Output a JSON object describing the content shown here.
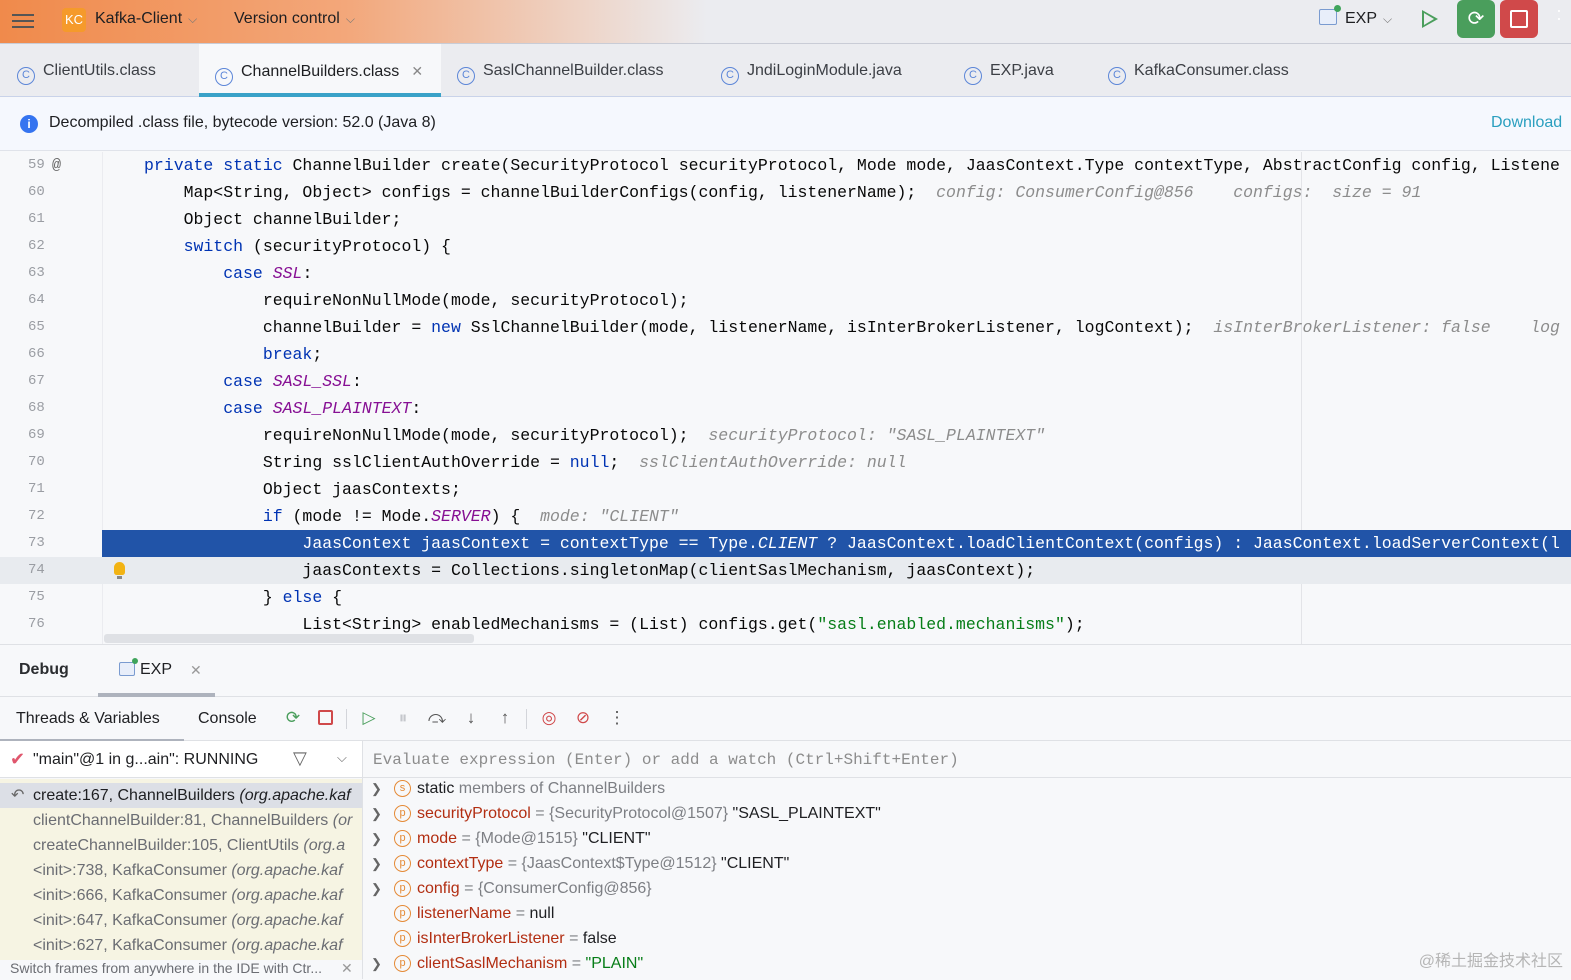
{
  "topbar": {
    "project_badge": "KC",
    "project": "Kafka-Client",
    "vcs": "Version control",
    "run_config": "EXP"
  },
  "tabs": [
    {
      "label": "ClientUtils.class",
      "active": false
    },
    {
      "label": "ChannelBuilders.class",
      "active": true
    },
    {
      "label": "SaslChannelBuilder.class",
      "active": false
    },
    {
      "label": "JndiLoginModule.java",
      "active": false
    },
    {
      "label": "EXP.java",
      "active": false
    },
    {
      "label": "KafkaConsumer.class",
      "active": false
    }
  ],
  "banner": {
    "text": "Decompiled .class file, bytecode version: 52.0 (Java 8)",
    "action": "Download"
  },
  "code": [
    {
      "n": "59",
      "t": [
        [
          "k",
          "private static "
        ],
        [
          "p",
          "ChannelBuilder create(SecurityProtocol securityProtocol, Mode mode, JaasContext.Type contextType, AbstractConfig config, Listene"
        ]
      ]
    },
    {
      "n": "60",
      "t": [
        [
          "p",
          "    Map<String, Object> configs = channelBuilderConfigs(config, listenerName);  "
        ],
        [
          "h",
          "config: ConsumerConfig@856    configs:  size = 91"
        ]
      ]
    },
    {
      "n": "61",
      "t": [
        [
          "p",
          "    Object channelBuilder;"
        ]
      ]
    },
    {
      "n": "62",
      "t": [
        [
          "k",
          "    switch "
        ],
        [
          "p",
          "(securityProtocol) {"
        ]
      ]
    },
    {
      "n": "63",
      "t": [
        [
          "k",
          "        case "
        ],
        [
          "e",
          "SSL"
        ],
        [
          "p",
          ":"
        ]
      ]
    },
    {
      "n": "64",
      "t": [
        [
          "p",
          "            requireNonNullMode(mode, securityProtocol);"
        ]
      ]
    },
    {
      "n": "65",
      "t": [
        [
          "p",
          "            channelBuilder = "
        ],
        [
          "k",
          "new "
        ],
        [
          "p",
          "SslChannelBuilder(mode, listenerName, isInterBrokerListener, logContext);  "
        ],
        [
          "h",
          "isInterBrokerListener: false    log"
        ]
      ]
    },
    {
      "n": "66",
      "t": [
        [
          "k",
          "            break"
        ],
        [
          "p",
          ";"
        ]
      ]
    },
    {
      "n": "67",
      "t": [
        [
          "k",
          "        case "
        ],
        [
          "e",
          "SASL_SSL"
        ],
        [
          "p",
          ":"
        ]
      ]
    },
    {
      "n": "68",
      "t": [
        [
          "k",
          "        case "
        ],
        [
          "e",
          "SASL_PLAINTEXT"
        ],
        [
          "p",
          ":"
        ]
      ]
    },
    {
      "n": "69",
      "t": [
        [
          "p",
          "            requireNonNullMode(mode, securityProtocol);  "
        ],
        [
          "h",
          "securityProtocol: \"SASL_PLAINTEXT\""
        ]
      ]
    },
    {
      "n": "70",
      "t": [
        [
          "p",
          "            String sslClientAuthOverride = "
        ],
        [
          "k",
          "null"
        ],
        [
          "p",
          ";  "
        ],
        [
          "h",
          "sslClientAuthOverride: null"
        ]
      ]
    },
    {
      "n": "71",
      "t": [
        [
          "p",
          "            Object jaasContexts;"
        ]
      ]
    },
    {
      "n": "72",
      "t": [
        [
          "k",
          "            if "
        ],
        [
          "p",
          "(mode != Mode."
        ],
        [
          "e",
          "SERVER"
        ],
        [
          "p",
          ") {  "
        ],
        [
          "h",
          "mode: \"CLIENT\""
        ]
      ]
    },
    {
      "n": "73",
      "t": [
        [
          "p",
          "                JaasContext jaasContext = contextType == Type."
        ],
        [
          "e",
          "CLIENT"
        ],
        [
          "p",
          " ? JaasContext.loadClientContext(configs) : JaasContext.loadServerContext(l"
        ]
      ]
    },
    {
      "n": "74",
      "t": [
        [
          "p",
          "                jaasContexts = Collections.singletonMap(clientSaslMechanism, jaasContext);"
        ]
      ]
    },
    {
      "n": "75",
      "t": [
        [
          "p",
          "            } "
        ],
        [
          "k",
          "else "
        ],
        [
          "p",
          "{"
        ]
      ]
    },
    {
      "n": "76",
      "t": [
        [
          "p",
          "                List<String> enabledMechanisms = (List) configs.get("
        ],
        [
          "s",
          "\"sasl.enabled.mechanisms\""
        ],
        [
          "p",
          ");"
        ]
      ]
    }
  ],
  "debug": {
    "title": "Debug",
    "session": "EXP",
    "subtabs": [
      "Threads & Variables",
      "Console"
    ],
    "thread": "\"main\"@1 in g...ain\": RUNNING",
    "eval_placeholder": "Evaluate expression (Enter) or add a watch (Ctrl+Shift+Enter)",
    "frames": [
      {
        "m": "create:167, ChannelBuilders ",
        "pkg": "(org.apache.kaf"
      },
      {
        "m": "clientChannelBuilder:81, ChannelBuilders ",
        "pkg": "(or"
      },
      {
        "m": "createChannelBuilder:105, ClientUtils ",
        "pkg": "(org.a"
      },
      {
        "m": "<init>:738, KafkaConsumer ",
        "pkg": "(org.apache.kaf"
      },
      {
        "m": "<init>:666, KafkaConsumer ",
        "pkg": "(org.apache.kaf"
      },
      {
        "m": "<init>:647, KafkaConsumer ",
        "pkg": "(org.apache.kaf"
      },
      {
        "m": "<init>:627, KafkaConsumer ",
        "pkg": "(org.apache.kaf"
      }
    ],
    "hint": "Switch frames from anywhere in the IDE with Ctr...",
    "vars": [
      {
        "icon": "s",
        "expand": true,
        "name": "static",
        "type": " members of ChannelBuilders",
        "val": ""
      },
      {
        "icon": "p",
        "expand": true,
        "name": "securityProtocol",
        "type": " = {SecurityProtocol@1507} ",
        "val": "\"SASL_PLAINTEXT\""
      },
      {
        "icon": "p",
        "expand": true,
        "name": "mode",
        "type": " = {Mode@1515} ",
        "val": "\"CLIENT\""
      },
      {
        "icon": "p",
        "expand": true,
        "name": "contextType",
        "type": " = {JaasContext$Type@1512} ",
        "val": "\"CLIENT\""
      },
      {
        "icon": "p",
        "expand": true,
        "name": "config",
        "type": " = {ConsumerConfig@856}",
        "val": ""
      },
      {
        "icon": "p",
        "expand": false,
        "name": "listenerName",
        "type": " = ",
        "val": "null"
      },
      {
        "icon": "p",
        "expand": false,
        "name": "isInterBrokerListener",
        "type": " = ",
        "val": "false"
      },
      {
        "icon": "p",
        "expand": true,
        "name": "clientSaslMechanism",
        "type": " = ",
        "val": "\"PLAIN\"",
        "str": true
      }
    ]
  },
  "watermark": "@稀土掘金技术社区"
}
